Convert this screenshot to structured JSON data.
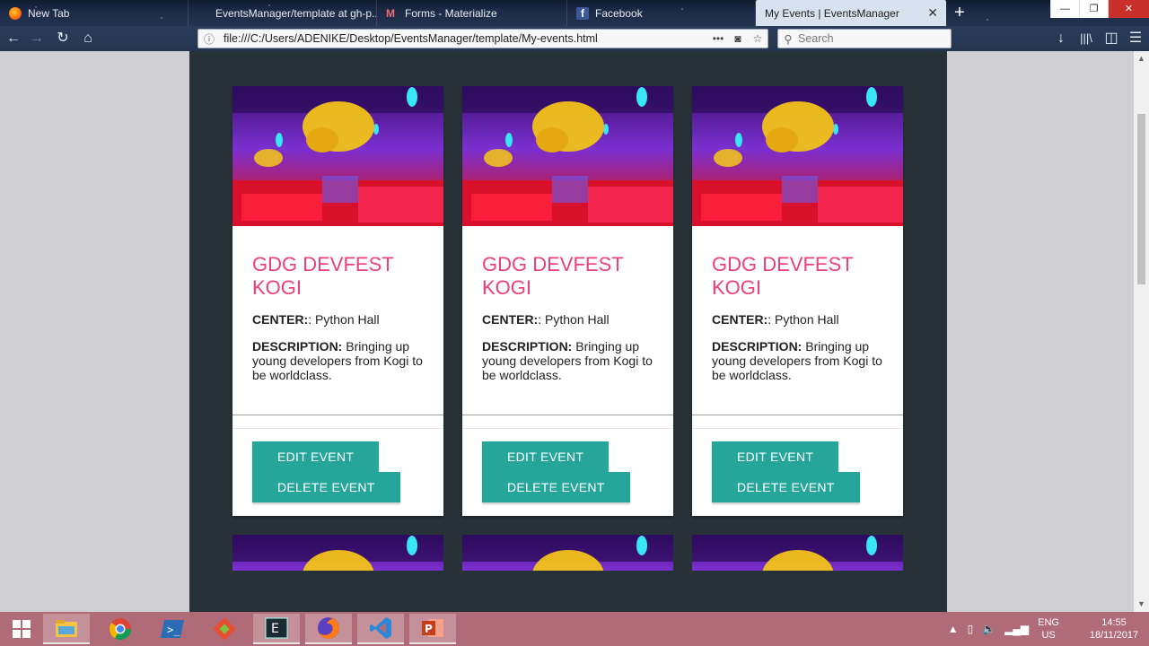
{
  "browser": {
    "tabs": [
      {
        "label": "New Tab",
        "favicon": "firefox-icon",
        "active": false
      },
      {
        "label": "EventsManager/template at gh-p...",
        "favicon": "github-icon",
        "active": false
      },
      {
        "label": "Forms - Materialize",
        "favicon": "materialize-icon",
        "active": false
      },
      {
        "label": "Facebook",
        "favicon": "facebook-icon",
        "active": false
      },
      {
        "label": "My Events | EventsManager",
        "favicon": "none",
        "active": true
      }
    ],
    "url": "file:///C:/Users/ADENIKE/Desktop/EventsManager/template/My-events.html",
    "search_placeholder": "Search",
    "page_actions": "•••"
  },
  "events": [
    {
      "title": "GDG DEVFEST KOGI",
      "center_label": "CENTER:",
      "center_value": ": Python Hall",
      "description_label": "DESCRIPTION:",
      "description_value": " Bringing up young developers from Kogi to be worldclass.",
      "edit_label": "EDIT EVENT",
      "delete_label": "DELETE EVENT"
    },
    {
      "title": "GDG DEVFEST KOGI",
      "center_label": "CENTER:",
      "center_value": ": Python Hall",
      "description_label": "DESCRIPTION:",
      "description_value": " Bringing up young developers from Kogi to be worldclass.",
      "edit_label": "EDIT EVENT",
      "delete_label": "DELETE EVENT"
    },
    {
      "title": "GDG DEVFEST KOGI",
      "center_label": "CENTER:",
      "center_value": ": Python Hall",
      "description_label": "DESCRIPTION:",
      "description_value": " Bringing up young developers from Kogi to be worldclass.",
      "edit_label": "EDIT EVENT",
      "delete_label": "DELETE EVENT"
    }
  ],
  "colors": {
    "page_background": "#263238",
    "title_accent": "#ec407a",
    "button": "#26a69a",
    "taskbar": "#b06b78"
  },
  "taskbar": {
    "apps": [
      "windows-start-icon",
      "file-explorer-icon",
      "chrome-icon",
      "powershell-icon",
      "git-icon",
      "editor-icon",
      "firefox-icon",
      "vscode-icon",
      "powerpoint-icon"
    ],
    "language": "ENG",
    "region": "US",
    "time": "14:55",
    "date": "18/11/2017"
  }
}
